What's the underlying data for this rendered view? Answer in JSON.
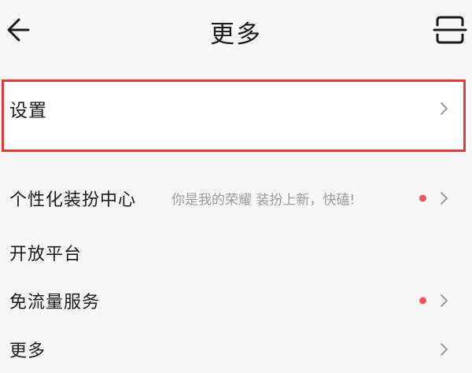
{
  "header": {
    "back_icon": "arrow-left-icon",
    "title": "更多",
    "scan_icon": "scan-icon"
  },
  "menu": {
    "settings": {
      "label": "设置",
      "chevron_icon": "chevron-right-icon"
    },
    "personalize": {
      "label": "个性化装扮中心",
      "subtitle": "你是我的荣耀 装扮上新，快磕!",
      "has_dot": true,
      "chevron_icon": "chevron-right-icon"
    },
    "open_platform": {
      "label": "开放平台"
    },
    "free_data": {
      "label": "免流量服务",
      "has_dot": true,
      "chevron_icon": "chevron-right-icon"
    },
    "more": {
      "label": "更多",
      "chevron_icon": "chevron-right-icon"
    }
  },
  "colors": {
    "highlight_border": "#e53935",
    "dot": "#f0575c",
    "subtitle_text": "#9a9a9a",
    "background": "#f7f7f7"
  }
}
